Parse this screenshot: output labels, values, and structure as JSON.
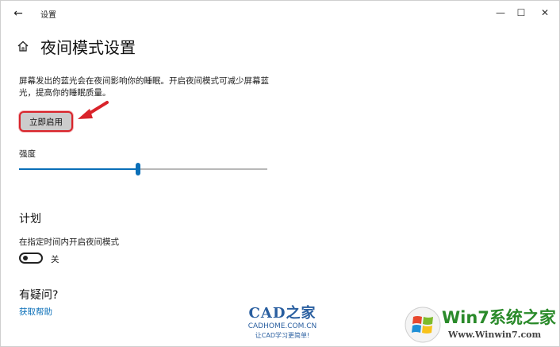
{
  "window": {
    "title": "设置",
    "back_glyph": "←",
    "minimize_glyph": "—",
    "maximize_glyph": "☐",
    "close_glyph": "✕"
  },
  "page": {
    "title": "夜间模式设置",
    "description": "屏幕发出的蓝光会在夜间影响你的睡眠。开启夜间模式可减少屏幕蓝光，提高你的睡眠质量。",
    "enable_button_label": "立即启用",
    "strength_label": "强度",
    "strength_value_percent": 48
  },
  "schedule": {
    "title": "计划",
    "label": "在指定时间内开启夜间模式",
    "toggle_state": "关"
  },
  "help": {
    "title": "有疑问?",
    "link": "获取帮助"
  },
  "watermarks": {
    "cad_title": "CAD之家",
    "cad_domain": "CADHOME.COM.CN",
    "cad_slogan": "让CAD学习更简单!",
    "win7_title": "Win7系统之家",
    "win7_url": "Www.Winwin7.com"
  },
  "colors": {
    "accent": "#0a6fb8",
    "highlight_border": "#d9232a",
    "button_bg": "#cccccc"
  }
}
